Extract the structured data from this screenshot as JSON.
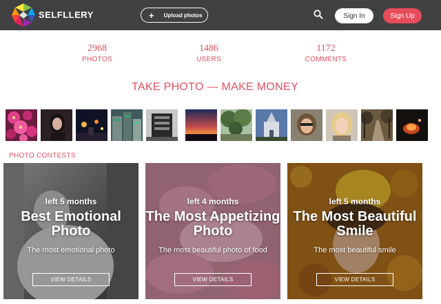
{
  "header": {
    "brand": "SELFLLERY",
    "upload_label": "Upload photos",
    "upload_icon": "+",
    "signin_label": "Sign In",
    "signup_label": "Sign Up",
    "bg_color": "#414042",
    "accent_color": "#e74c5a"
  },
  "stats": [
    {
      "value": "2968",
      "label": "PHOTOS"
    },
    {
      "value": "1486",
      "label": "USERS"
    },
    {
      "value": "1172",
      "label": "COMMENTS"
    }
  ],
  "tagline": "TAKE PHOTO — MAKE MONEY",
  "gallery": {
    "thumbnails": [
      "pink-flowers",
      "woman-portrait-dark",
      "night-street",
      "city-buildings",
      "bw-machine",
      "sunset-sky",
      "forest-trees",
      "church-building",
      "woman-selfie-car",
      "blonde-girl",
      "autumn-path",
      "night-fire"
    ]
  },
  "contests": {
    "section_title": "PHOTO CONTESTS",
    "cards": [
      {
        "left": "left 5 months",
        "title": "Best Emotional Photo",
        "subtitle": "The most emotional photo",
        "button": "VIEW DETAILS",
        "image": "bw-woman-emotional"
      },
      {
        "left": "left 4 months",
        "title": "The Most Appetizing Photo",
        "subtitle": "The most beautiful photo of food",
        "button": "VIEW DETAILS",
        "image": "pink-macarons"
      },
      {
        "left": "left 5 months",
        "title": "The Most Beautiful Smile",
        "subtitle": "The most beautiful smile",
        "button": "VIEW DETAILS",
        "image": "girl-autumn-leaves"
      }
    ]
  }
}
